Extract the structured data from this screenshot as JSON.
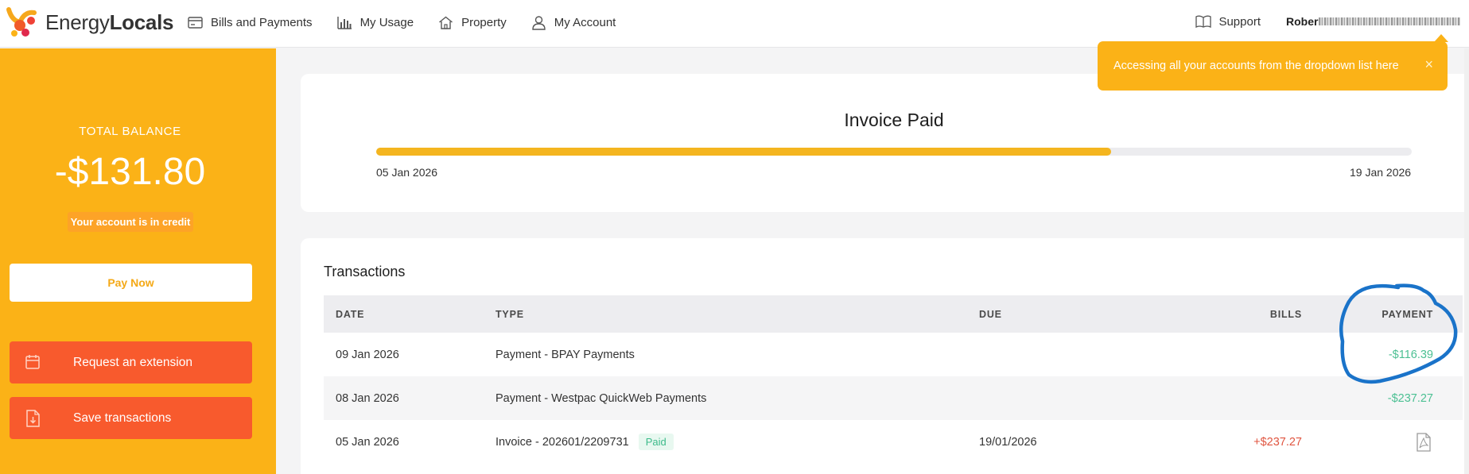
{
  "brand": {
    "name_regular": "Energy",
    "name_bold": "Locals"
  },
  "nav": {
    "items": [
      {
        "label": "Bills and Payments",
        "icon": "card-icon"
      },
      {
        "label": "My Usage",
        "icon": "bar-chart-icon"
      },
      {
        "label": "Property",
        "icon": "home-icon"
      },
      {
        "label": "My Account",
        "icon": "user-icon"
      }
    ],
    "support_label": "Support",
    "user_name_visible": "Rober"
  },
  "tooltip": {
    "text": "Accessing all your accounts from the dropdown list here",
    "close": "×"
  },
  "balance": {
    "label": "TOTAL BALANCE",
    "amount": "-$131.80",
    "status": "Your account is in credit"
  },
  "actions": {
    "pay_now": "Pay Now",
    "request_extension": "Request an extension",
    "save_transactions": "Save transactions"
  },
  "invoice": {
    "title": "Invoice Paid",
    "progress_fraction": 0.71,
    "start_date": "05 Jan 2026",
    "end_date": "19 Jan 2026"
  },
  "transactions": {
    "title": "Transactions",
    "columns": [
      "DATE",
      "TYPE",
      "DUE",
      "BILLS",
      "PAYMENT"
    ],
    "rows": [
      {
        "date": "09 Jan 2026",
        "type": "Payment - BPAY Payments",
        "badge": "",
        "due": "",
        "bills": "",
        "payment": "-$116.39"
      },
      {
        "date": "08 Jan 2026",
        "type": "Payment - Westpac QuickWeb Payments",
        "badge": "",
        "due": "",
        "bills": "",
        "payment": "-$237.27"
      },
      {
        "date": "05 Jan 2026",
        "type": "Invoice - 202601/2209731",
        "badge": "Paid",
        "due": "19/01/2026",
        "bills": "+$237.27",
        "payment": ""
      }
    ]
  },
  "colors": {
    "brand_orange": "#fbb217",
    "action_red": "#f85a2d",
    "credit_green": "#4cc093",
    "debit_red": "#e05540",
    "annotation_blue": "#1a73c9"
  }
}
